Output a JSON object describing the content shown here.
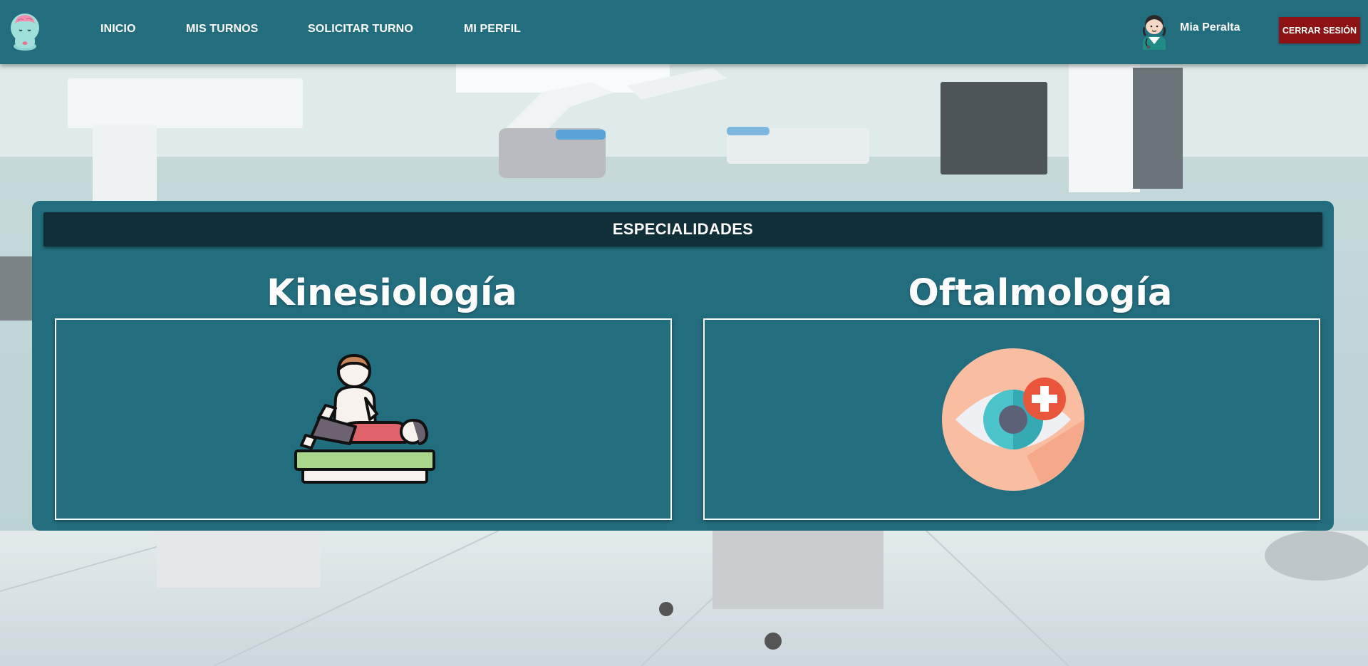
{
  "app": {
    "logo_icon": "brain-mascot-icon"
  },
  "nav": {
    "items": [
      {
        "label": "INICIO"
      },
      {
        "label": "MIS TURNOS"
      },
      {
        "label": "SOLICITAR TURNO"
      },
      {
        "label": "MI PERFIL"
      }
    ]
  },
  "user": {
    "name": "Mia Peralta",
    "avatar_icon": "doctor-avatar-icon",
    "logout_label": "CERRAR SESIÓN"
  },
  "panel": {
    "title": "ESPECIALIDADES",
    "specialties": [
      {
        "name": "Kinesiología",
        "icon": "physiotherapy-icon"
      },
      {
        "name": "Oftalmología",
        "icon": "eye-care-icon"
      }
    ]
  },
  "colors": {
    "navbar": "#236e7e",
    "panel": "#236e7e",
    "panel_header": "#102f38",
    "logout_button": "#8e1214"
  }
}
